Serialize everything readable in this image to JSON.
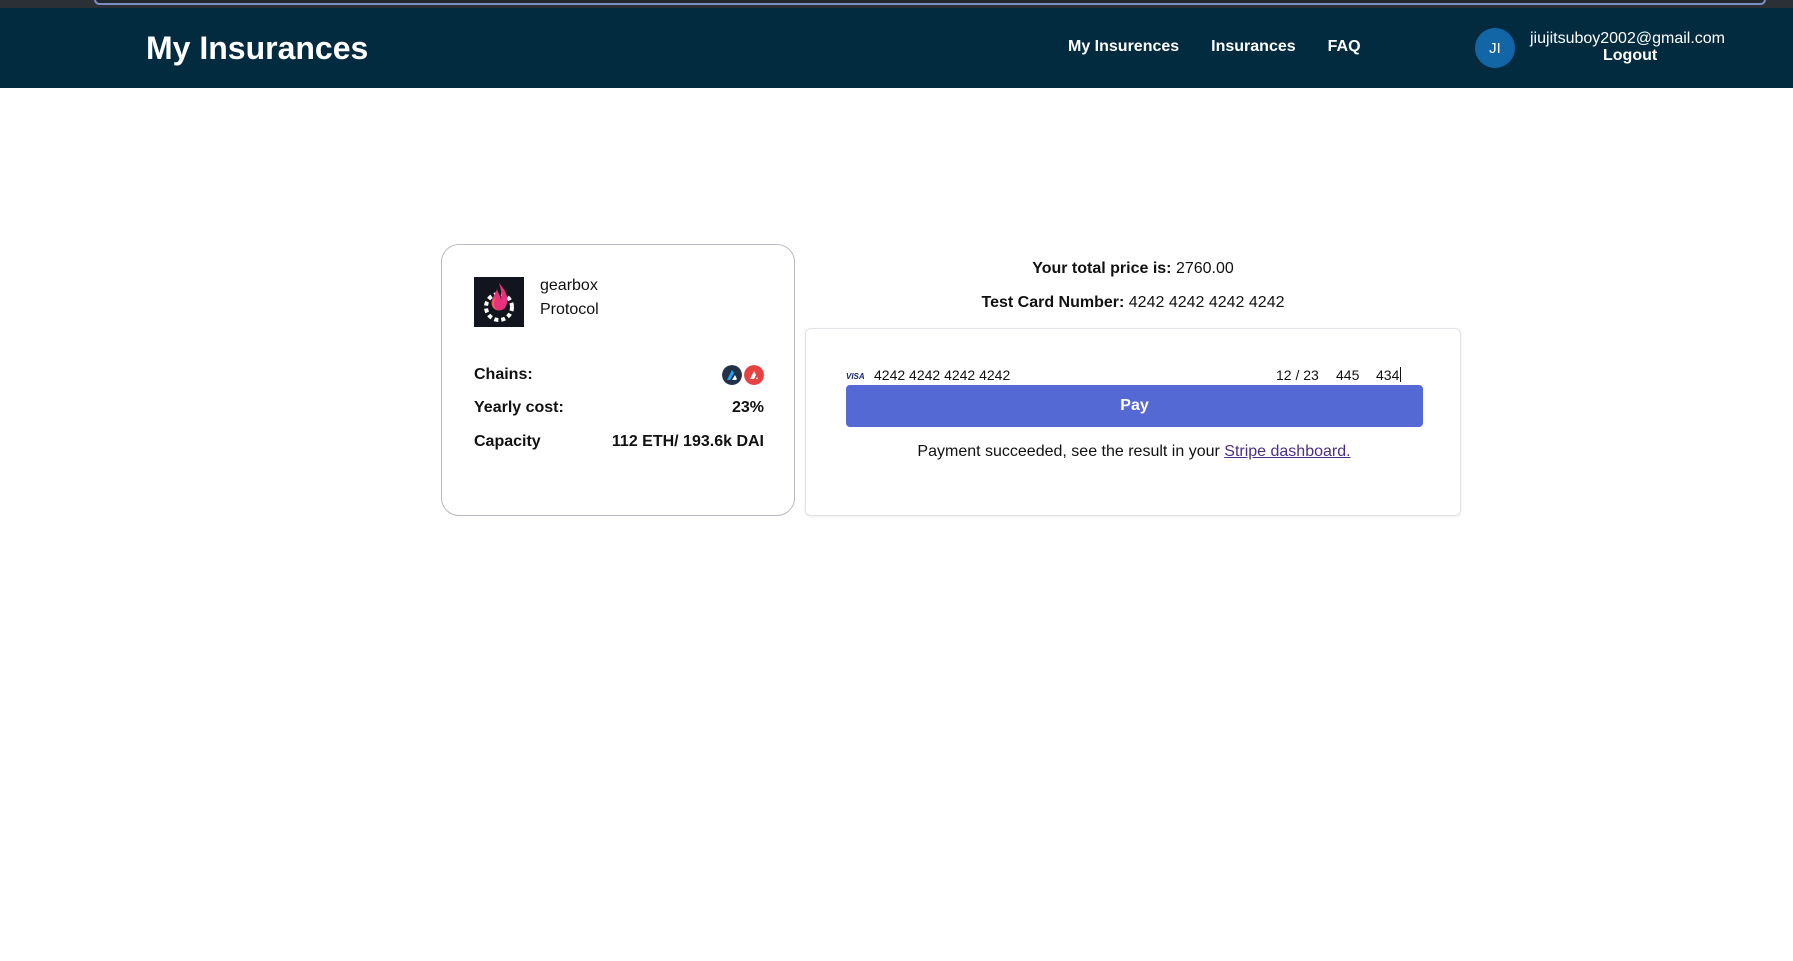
{
  "header": {
    "brand": "My Insurances",
    "nav": [
      "My Insurences",
      "Insurances",
      "FAQ"
    ],
    "avatar_initials": "JI",
    "user_email": "jiujitsuboy2002@gmail.com",
    "logout_label": "Logout"
  },
  "protocol": {
    "name": "gearbox",
    "type": "Protocol",
    "chains_label": "Chains:",
    "chain_icons": [
      "arbitrum-icon",
      "avalanche-icon"
    ],
    "yearly_cost_label": "Yearly cost:",
    "yearly_cost_value": "23%",
    "capacity_label": "Capacity",
    "capacity_value": "112 ETH/ 193.6k DAI"
  },
  "payment": {
    "total_label": "Your total price is:",
    "total_value": "2760.00",
    "test_card_label": "Test Card Number:",
    "test_card_value": "4242 4242 4242 4242",
    "card_brand": "VISA",
    "card_number": "4242 4242 4242 4242",
    "card_expiry": "12 / 23",
    "card_cvc": "445",
    "card_zip": "434",
    "pay_label": "Pay",
    "result_text": "Payment succeeded, see the result in your ",
    "result_link": "Stripe dashboard."
  },
  "colors": {
    "header_bg": "#022b40",
    "pay_button": "#5469d4",
    "avatar_bg": "#1366a6"
  }
}
